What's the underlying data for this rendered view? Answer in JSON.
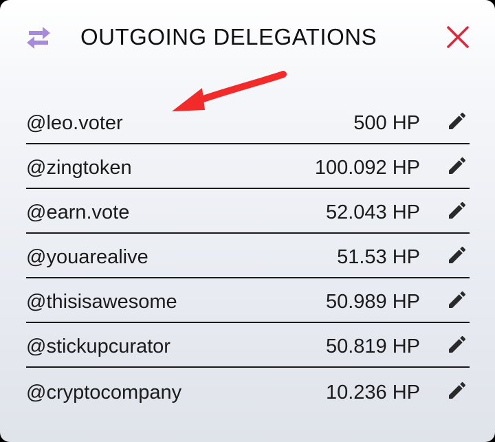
{
  "dialog": {
    "title": "OUTGOING DELEGATIONS",
    "header_icon": "swap-arrows-icon",
    "close_icon": "close-icon",
    "accent_color": "#a78bdb",
    "close_color": "#e0283c"
  },
  "annotation": {
    "type": "red-arrow",
    "color": "#f22a2a"
  },
  "delegations": [
    {
      "account": "@leo.voter",
      "amount": "500 HP"
    },
    {
      "account": "@zingtoken",
      "amount": "100.092 HP"
    },
    {
      "account": "@earn.vote",
      "amount": "52.043 HP"
    },
    {
      "account": "@youarealive",
      "amount": "51.53 HP"
    },
    {
      "account": "@thisisawesome",
      "amount": "50.989 HP"
    },
    {
      "account": "@stickupcurator",
      "amount": "50.819 HP"
    },
    {
      "account": "@cryptocompany",
      "amount": "10.236 HP"
    }
  ],
  "row_action_icon": "pencil-edit-icon"
}
